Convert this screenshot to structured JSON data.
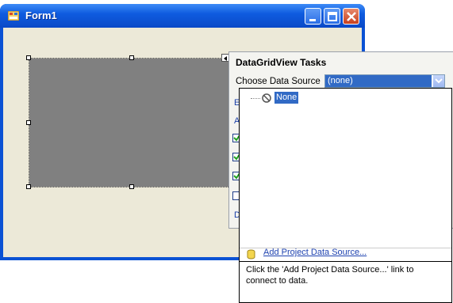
{
  "window": {
    "title": "Form1"
  },
  "tasks_panel": {
    "title": "DataGridView Tasks",
    "datasource_label": "Choose Data Source",
    "datasource_value": "(none)",
    "stub_labels": [
      "E",
      "A",
      "D"
    ]
  },
  "dropdown": {
    "tree_item": "None",
    "add_link": "Add Project Data Source...",
    "description": "Click the 'Add Project Data Source...' link to connect to data."
  },
  "colors": {
    "titlebar": "#0f5ce0",
    "client": "#ece9d8",
    "selection": "#316ac5",
    "grid": "#808080"
  }
}
